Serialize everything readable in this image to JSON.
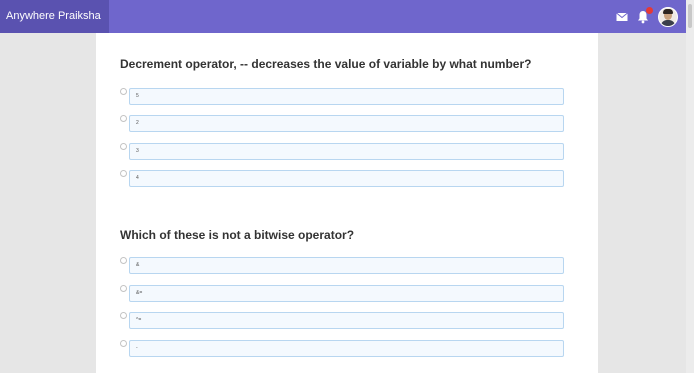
{
  "app": {
    "title": "Anywhere Praiksha"
  },
  "header": {
    "icons": [
      "mail-icon",
      "bell-icon",
      "avatar"
    ],
    "colors": {
      "bar": "#6f66cc",
      "brand_bg": "#5a52b0",
      "badge": "#e53935"
    }
  },
  "questions": [
    {
      "text": "Decrement operator, -- decreases the value of variable by what number?",
      "options": [
        {
          "label": "5"
        },
        {
          "label": "2"
        },
        {
          "label": "3"
        },
        {
          "label": "4"
        }
      ]
    },
    {
      "text": "Which of these is not a bitwise operator?",
      "options": [
        {
          "label": "&"
        },
        {
          "label": "&="
        },
        {
          "label": "^="
        },
        {
          "label": "-"
        }
      ]
    }
  ]
}
